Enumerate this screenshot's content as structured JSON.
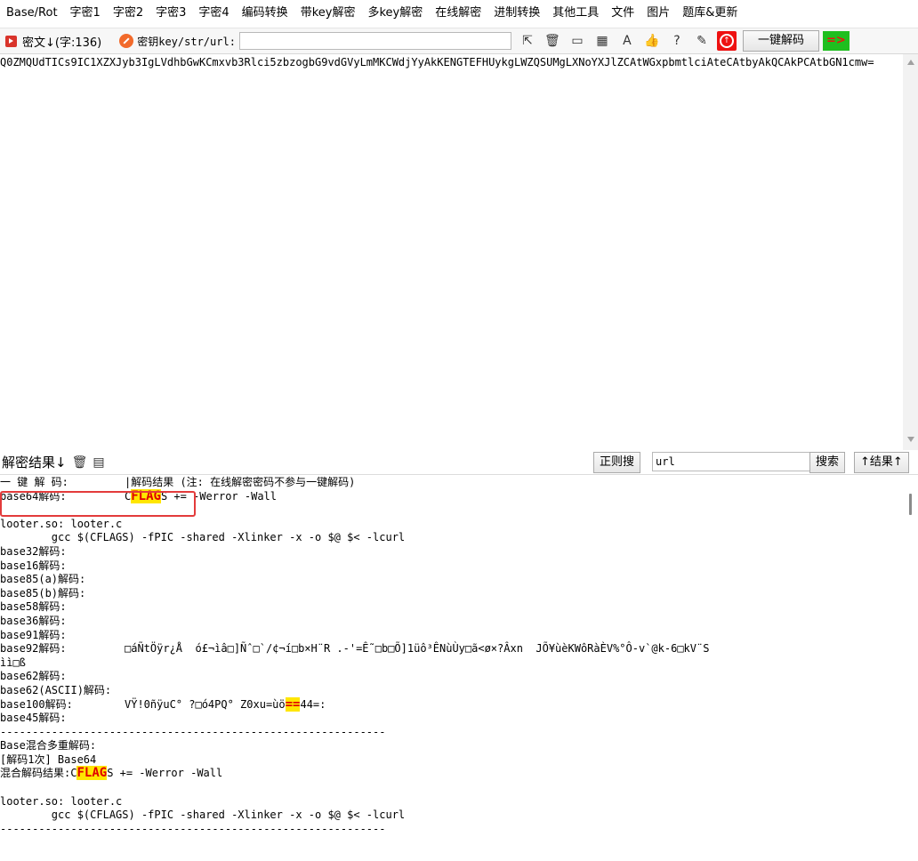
{
  "menu": [
    "Base/Rot",
    "字密1",
    "字密2",
    "字密3",
    "字密4",
    "编码转换",
    "带key解密",
    "多key解密",
    "在线解密",
    "进制转换",
    "其他工具",
    "文件",
    "图片",
    "题库&更新"
  ],
  "toolbar": {
    "cipher_label": "密文↓(字:136)",
    "key_label": "密钥key/str/url:",
    "key_value": "",
    "tool_icons": [
      "cursor-icon",
      "trash-icon",
      "terminal-icon",
      "calculator-icon",
      "font-icon",
      "thumbs-up-icon",
      "help-icon",
      "edit-icon",
      "run-icon"
    ],
    "decode_label": "一键解码",
    "arrow_label": "=>"
  },
  "cipher_text": "Q0ZMQUdTICs9IC1XZXJyb3IgLVdhbGwKCmxvb3Rlci5zbzogbG9vdGVyLmMKCWdjYyAkKENGTEFHUykgLWZQSUMgLXNoYXJlZCAtWGxpbmtlciAteCAtbyAkQCAkPCAtbGN1cmw=",
  "result_bar": {
    "title": "解密结果↓",
    "regex_label": "正则搜",
    "search_value": "url",
    "search_label": "搜索",
    "up_label": "↑结果↑"
  },
  "output": {
    "header_label": "一 键 解 码:",
    "header_value": "|解码结果 (注: 在线解密密码不参与一键解码)",
    "base64_label": "base64解码:",
    "base64_pre": "C",
    "base64_hl": "FLAG",
    "base64_post": "S += -Werror -Wall",
    "looter_line": "looter.so: looter.c",
    "gcc_line": "        gcc $(CFLAGS) -fPIC -shared -Xlinker -x -o $@ $< -lcurl",
    "empty_decoders": [
      "base32解码:",
      "base16解码:",
      "base85(a)解码:",
      "base85(b)解码:",
      "base58解码:",
      "base36解码:",
      "base91解码:"
    ],
    "base92_label": "base92解码:",
    "base92_value": "□áÑtÖÿr¿Å  ó£¬ìâ□]Ñˆ□`/¢¬í□b×H¨R .-'=Ê˜□b□Õ]1üô³ÊNùÙy□ã<ø×?Âxn  JÕ¥ùèKWôRàÈV%°Ô-v`@k-6□kV¨S",
    "base92_cont": "ìì□ß",
    "base62_label": "base62解码:",
    "base62ascii_label": "base62(ASCII)解码:",
    "base100_label": "base100解码:",
    "base100_pre": "VŸ!0ñÿuC° ?□ó4PQ° Z0xu=ùö",
    "base100_hl": "==",
    "base100_post": "44=:",
    "base45_label": "base45解码:",
    "separator": "------------------------------------------------------------",
    "mix_title": "Base混合多重解码:",
    "mix_step": "[解码1次] Base64",
    "mix_label": "混合解码结果:",
    "mix_pre": "C",
    "mix_hl": "FLAG",
    "mix_post": "S += -Werror -Wall"
  }
}
